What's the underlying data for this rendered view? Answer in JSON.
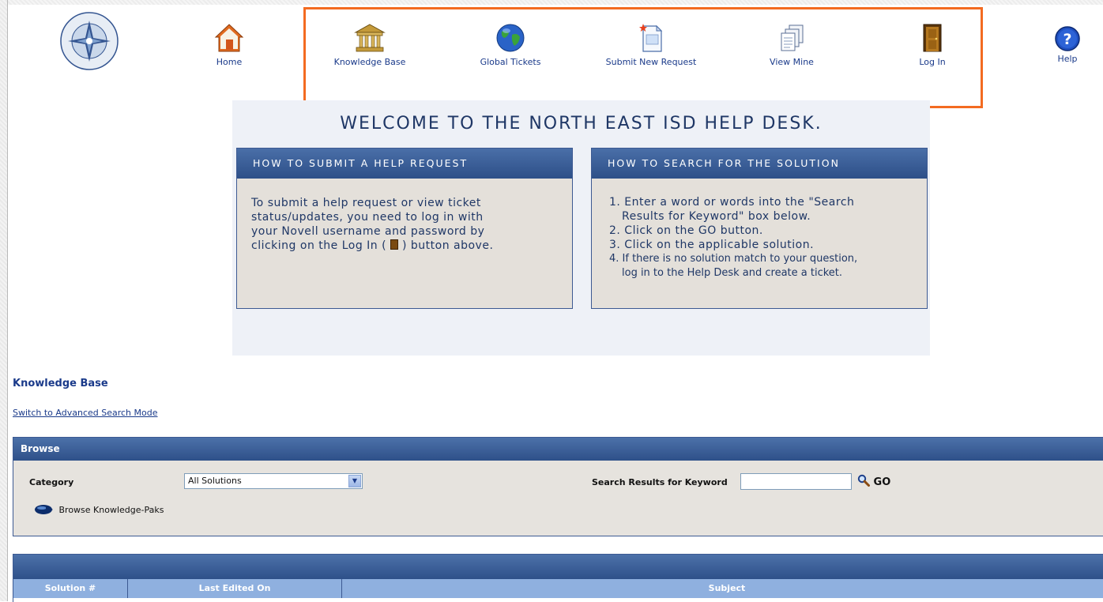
{
  "toolbar": {
    "items": [
      {
        "label": "Home",
        "icon": "home-icon"
      },
      {
        "label": "Knowledge Base",
        "icon": "building-icon"
      },
      {
        "label": "Global Tickets",
        "icon": "globe-icon"
      },
      {
        "label": "Submit New Request",
        "icon": "new-document-icon"
      },
      {
        "label": "View Mine",
        "icon": "documents-icon"
      },
      {
        "label": "Log In",
        "icon": "door-icon"
      },
      {
        "label": "Help",
        "icon": "help-icon"
      }
    ],
    "highlight_color": "#f36b21"
  },
  "welcome": {
    "title": "WELCOME TO THE NORTH EAST ISD HELP DESK.",
    "submit_card": {
      "heading": "HOW TO SUBMIT A HELP REQUEST",
      "line1": "To submit a help request or view ticket",
      "line2": "status/updates, you need to log in with",
      "line3": "your Novell username and password by",
      "line4a": "clicking on the Log In (",
      "line4b": ") button above."
    },
    "search_card": {
      "heading": "HOW TO SEARCH FOR THE SOLUTION",
      "steps": [
        "1. Enter a word or words into the \"Search",
        "Results for Keyword\" box below.",
        "2. Click on the GO button.",
        "3. Click on the applicable solution.",
        "4. If there is no solution match to your question,",
        "log in to the Help Desk and create a ticket."
      ]
    }
  },
  "knowledge_base": {
    "title": "Knowledge Base",
    "switch_link": "Switch to Advanced Search Mode",
    "browse": {
      "heading": "Browse",
      "category_label": "Category",
      "category_value": "All Solutions",
      "keyword_label": "Search Results for Keyword",
      "keyword_value": "",
      "go_label": "GO",
      "paks_label": "Browse Knowledge-Paks"
    },
    "results": {
      "columns": [
        "Solution #",
        "Last Edited On",
        "Subject"
      ]
    }
  },
  "colors": {
    "header_blue": "#2e5089",
    "column_blue": "#8fb0df",
    "text_blue": "#1a3a8a"
  }
}
